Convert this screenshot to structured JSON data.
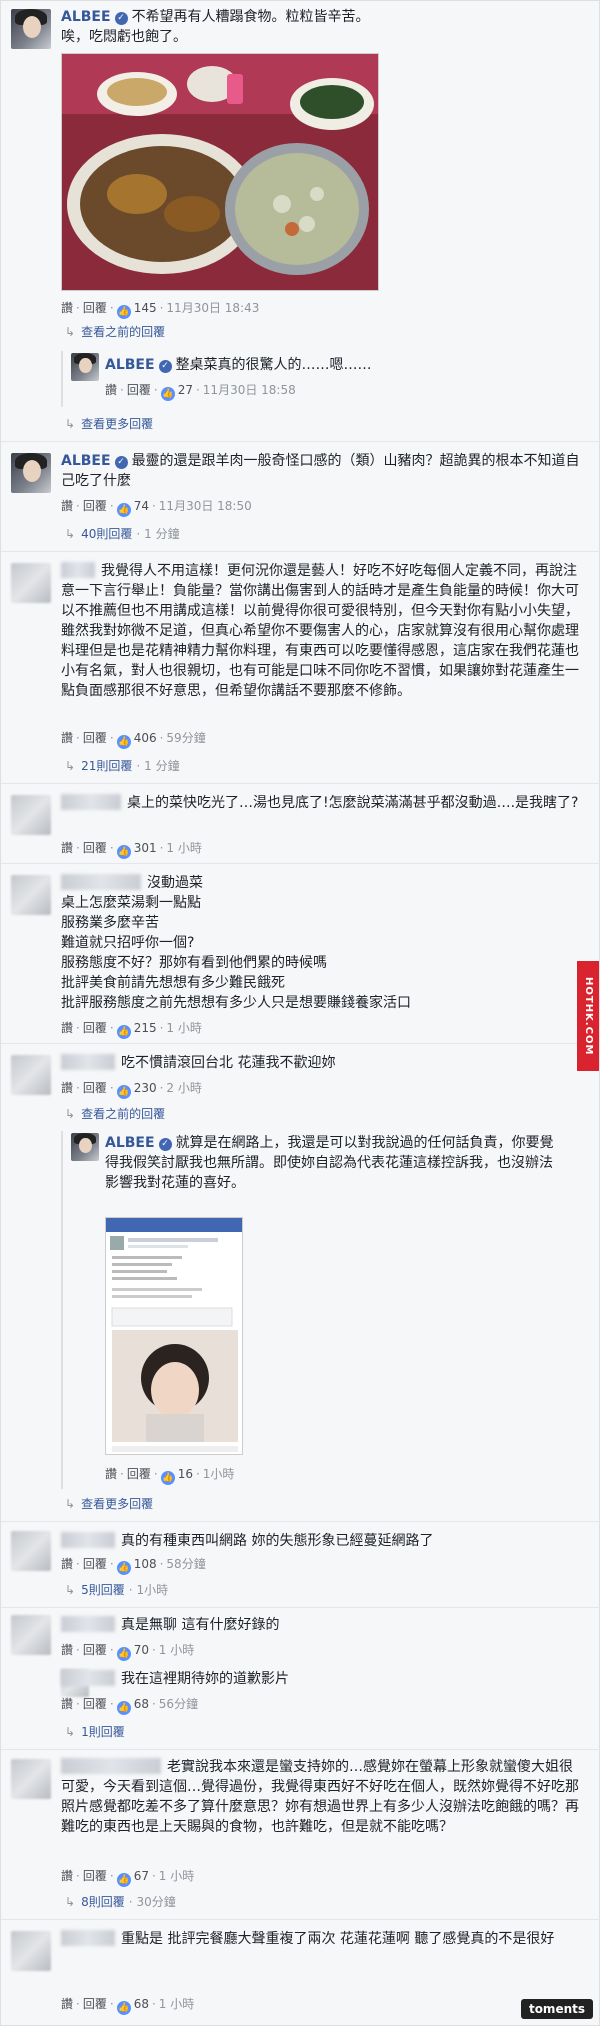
{
  "actions": {
    "like": "讚",
    "reply": "回覆",
    "sep": "·"
  },
  "c1": {
    "name": "ALBEE",
    "text": "不希望再有人糟蹋食物。粒粒皆辛苦。唉，吃悶虧也飽了。",
    "likes": "145",
    "time": "11月30日 18:43",
    "earlier": "查看之前的回覆",
    "reply": {
      "name": "ALBEE",
      "text": "整桌菜真的很驚人的……嗯……",
      "likes": "27",
      "time": "11月30日 18:58"
    },
    "more": "查看更多回覆"
  },
  "c2": {
    "name": "ALBEE",
    "text": "最靈的還是跟羊肉一般奇怪口感的（類）山豬肉？超詭異的根本不知道自己吃了什麼",
    "likes": "74",
    "time": "11月30日 18:50",
    "replies": "40則回覆",
    "replies_time": "1 分鐘"
  },
  "c3": {
    "text": "我覺得人不用這樣！更何況你還是藝人！好吃不好吃每個人定義不同，再說注意一下言行舉止！負能量？當你講出傷害到人的話時才是產生負能量的時候！你大可以不推薦但也不用講成這樣！以前覺得你很可愛很特別，但今天對你有點小小失望，雖然我對妳微不足道，但真心希望你不要傷害人的心，店家就算沒有很用心幫你處理料理但是也是花精神精力幫你料理，有東西可以吃要懂得感恩，這店家在我們花蓮也小有名氣，對人也很親切，也有可能是口味不同你吃不習慣，如果讓妳對花蓮產生一點負面感那很不好意思，但希望你講話不要那麼不修飾。",
    "likes": "406",
    "time": "59分鐘",
    "replies": "21則回覆",
    "replies_time": "1 分鐘"
  },
  "c4": {
    "text": "桌上的菜快吃光了…湯也見底了!怎麼說菜滿滿甚乎都沒動過….是我瞎了?",
    "likes": "301",
    "time": "1 小時"
  },
  "c5": {
    "lines": [
      "沒動過菜",
      "桌上怎麼菜湯剩一點點",
      "服務業多麼辛苦",
      "難道就只招呼你一個?",
      "服務態度不好？那妳有看到他們累的時候嗎",
      "批評美食前請先想想有多少難民餓死",
      "批評服務態度之前先想想有多少人只是想要賺錢養家活口"
    ],
    "likes": "215",
    "time": "1 小時"
  },
  "c6": {
    "text": "吃不慣請滾回台北 花蓮我不歡迎妳",
    "likes": "230",
    "time": "2 小時",
    "earlier": "查看之前的回覆",
    "reply": {
      "name": "ALBEE",
      "text": "就算是在網路上，我還是可以對我說過的任何話負責，你要覺得我假笑討厭我也無所謂。即使妳自認為代表花蓮這樣控訴我，也沒辦法影響我對花蓮的喜好。",
      "likes": "16",
      "time": "1小時"
    },
    "more": "查看更多回覆"
  },
  "c7": {
    "text": "真的有種東西叫網路 妳的失態形象已經蔓延網路了",
    "likes": "108",
    "time": "58分鐘",
    "replies": "5則回覆",
    "replies_time": "1小時"
  },
  "c8": {
    "text": "真是無聊 這有什麼好錄的",
    "likes": "70",
    "time": "1 小時"
  },
  "c9": {
    "text": "我在這裡期待妳的道歉影片",
    "likes": "68",
    "time": "56分鐘",
    "replies": "1則回覆"
  },
  "c10": {
    "text": "老實說我本來還是蠻支持妳的…感覺妳在螢幕上形象就蠻傻大姐很可愛，今天看到這個…覺得過份，我覺得東西好不好吃在個人，既然妳覺得不好吃那照片感覺都吃差不多了算什麼意思？妳有想過世界上有多少人沒辦法吃飽餓的嗎？再難吃的東西也是上天賜與的食物，也許難吃，但是就不能吃嗎？",
    "likes": "67",
    "time": "1 小時",
    "replies": "8則回覆",
    "replies_time": "30分鐘"
  },
  "c11": {
    "text": "重點是 批評完餐廳大聲重複了兩次 花蓮花蓮啊 聽了感覺真的不是很好",
    "likes": "68",
    "time": "1 小時"
  },
  "watermark": "HOTHK.COM",
  "footer_badge": "toments",
  "colors": {
    "link": "#365899",
    "like_badge": "#5890ff",
    "verified": "#4267b2",
    "watermark": "#d9232e"
  }
}
